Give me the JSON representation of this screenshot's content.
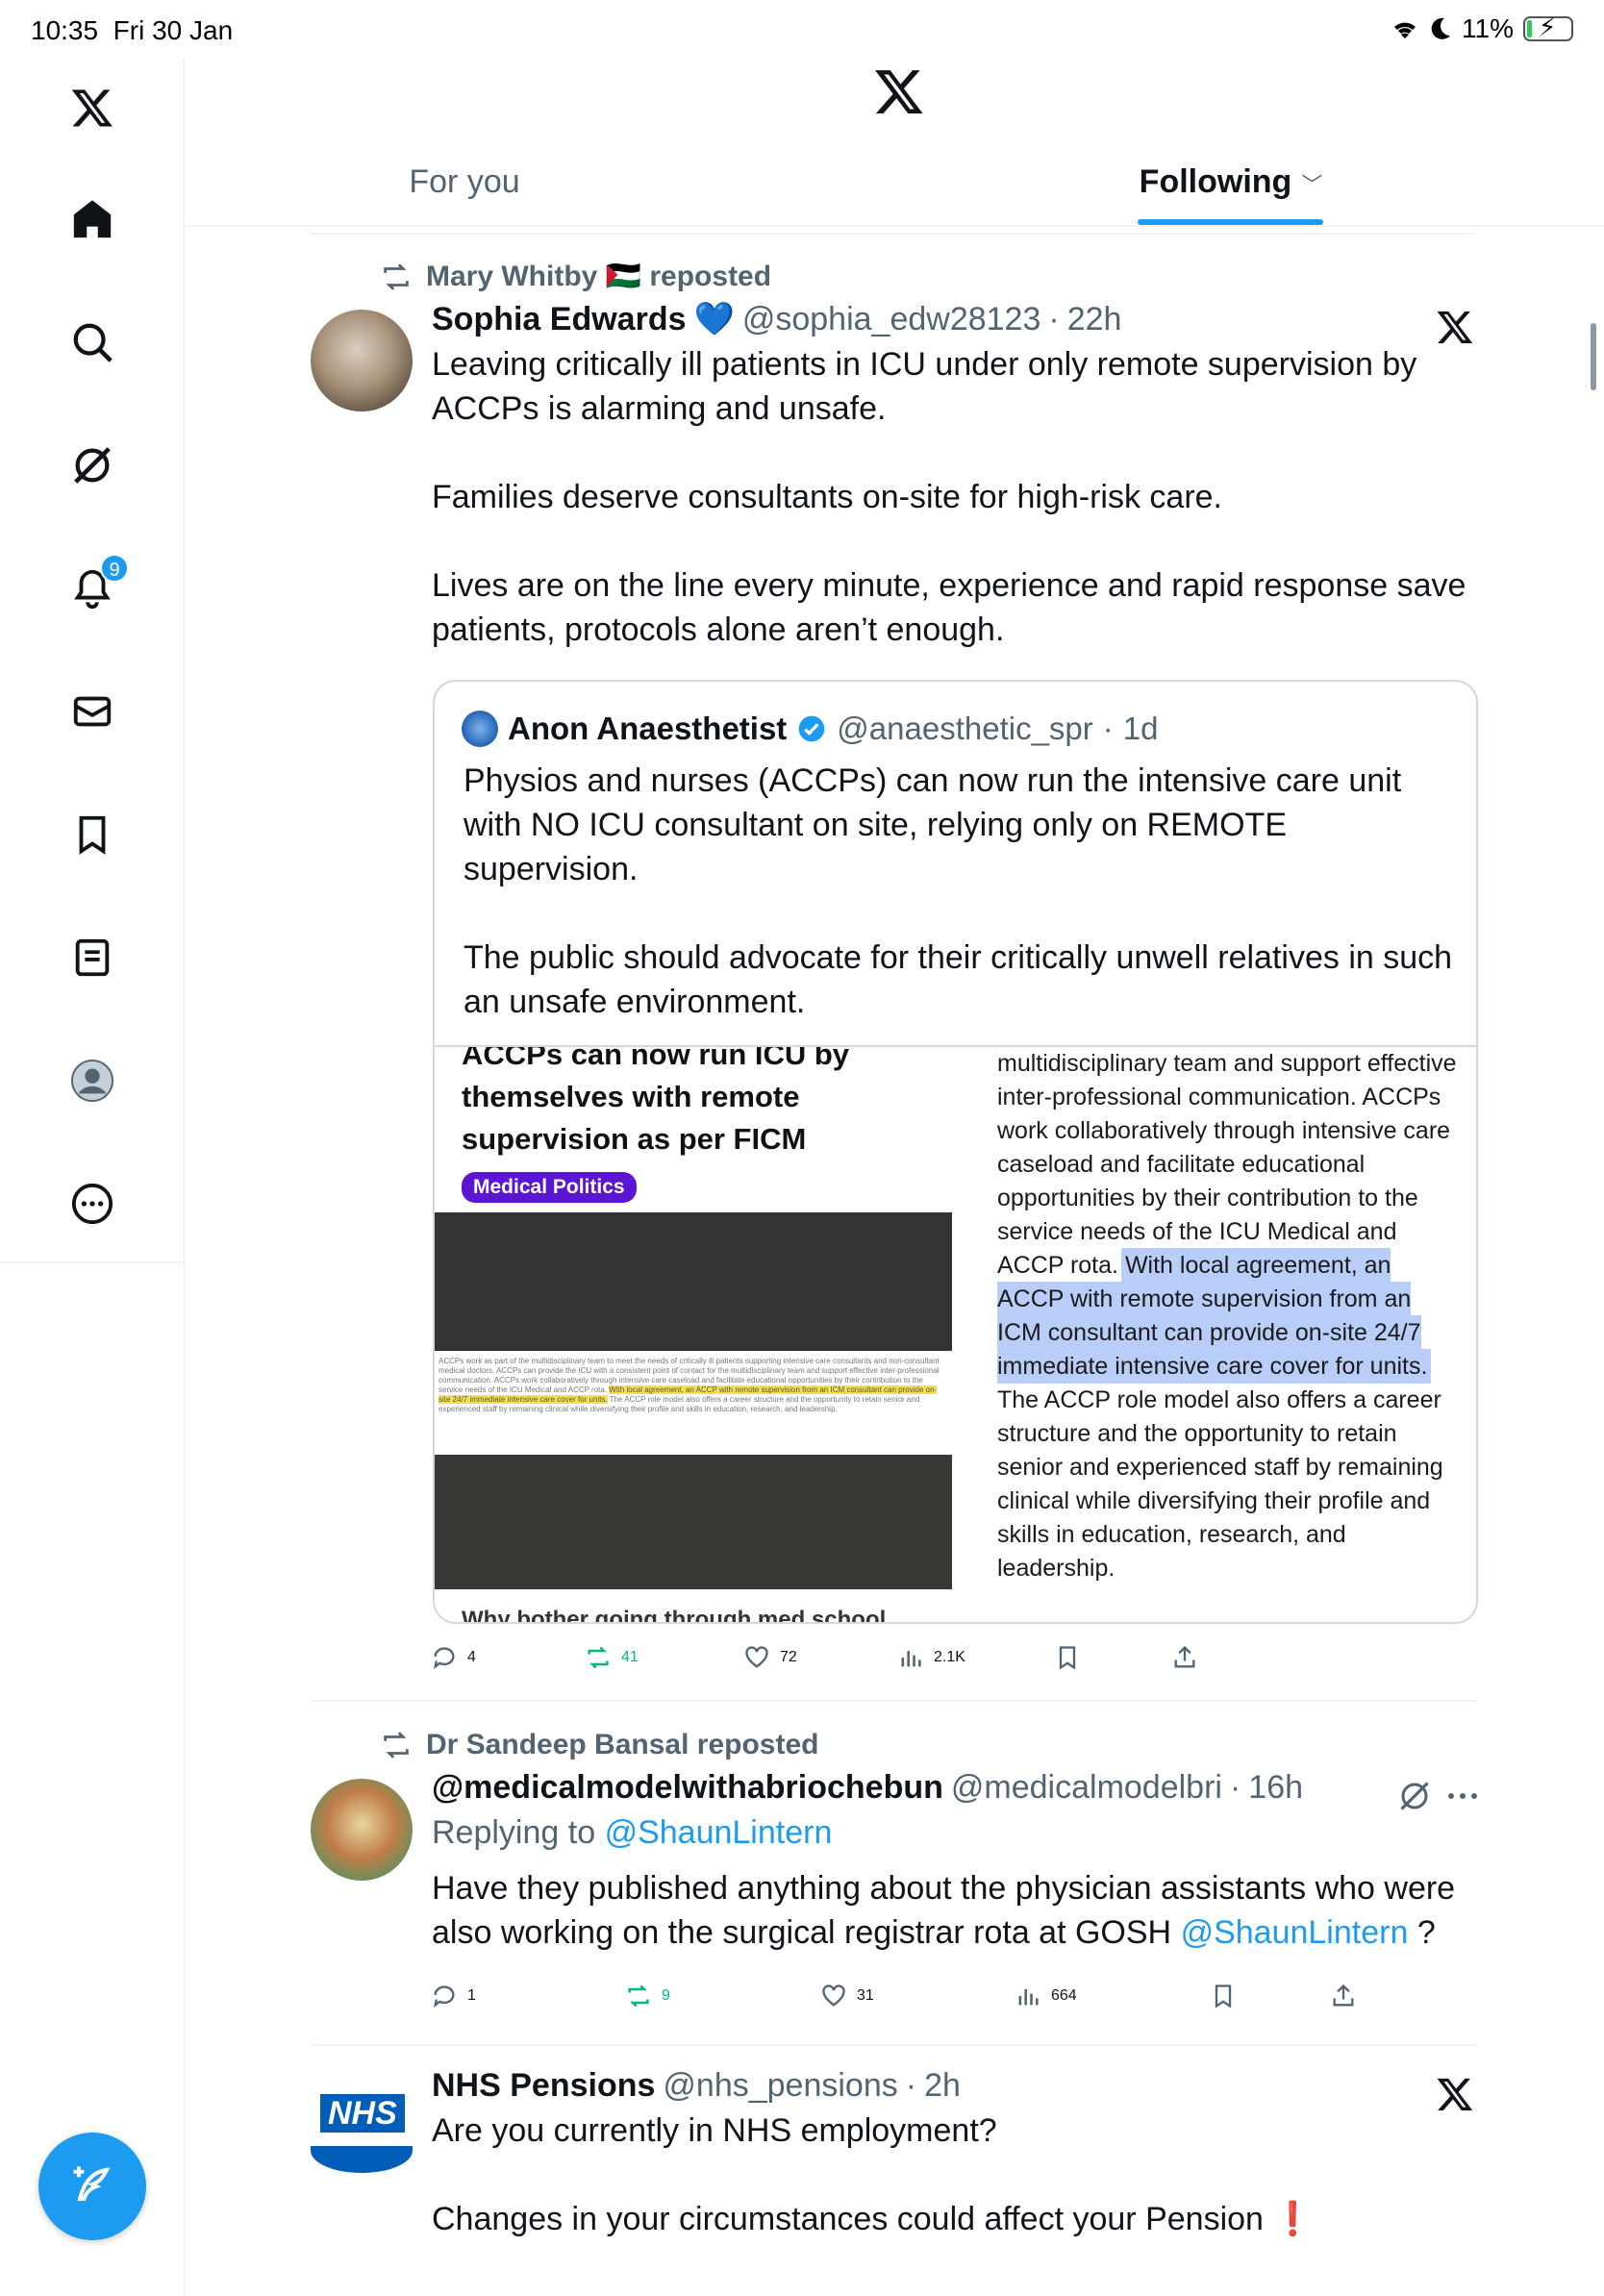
{
  "status_bar": {
    "time": "10:35",
    "date": "Fri 30 Jan",
    "battery": "11%",
    "battery_level": 0.11
  },
  "sidebar": {
    "items": [
      {
        "name": "home",
        "icon": "home-icon"
      },
      {
        "name": "explore",
        "icon": "search-icon"
      },
      {
        "name": "grok",
        "icon": "grok-icon"
      },
      {
        "name": "notifications",
        "icon": "bell-icon",
        "badge": "9"
      },
      {
        "name": "messages",
        "icon": "mail-icon"
      },
      {
        "name": "bookmarks",
        "icon": "bookmark-icon"
      },
      {
        "name": "lists",
        "icon": "list-icon"
      },
      {
        "name": "profile",
        "icon": "profile-icon"
      },
      {
        "name": "more",
        "icon": "more-icon"
      }
    ],
    "compose_icon": "compose-icon"
  },
  "header": {
    "tabs": [
      {
        "label": "For you",
        "active": false
      },
      {
        "label": "Following",
        "active": true
      }
    ]
  },
  "posts": [
    {
      "social_context": "Mary Whitby 🇵🇸 reposted",
      "name": "Sophia Edwards",
      "name_emoji": "💙",
      "handle": "@sophia_edw28123",
      "time": "22h",
      "paragraphs": [
        "Leaving critically ill patients in ICU under only remote supervision by ACCPs is alarming and unsafe.",
        "Families deserve consultants on-site for high-risk care.",
        "Lives are on the line every minute, experience and rapid response save patients, protocols alone aren’t enough."
      ],
      "quote": {
        "name": "Anon Anaesthetist",
        "handle": "@anaesthetic_spr",
        "time": "1d",
        "paragraphs": [
          "Physios and nurses (ACCPs) can now run the intensive care unit with NO ICU consultant on site, relying only on REMOTE supervision.",
          "The public should advocate for their critically unwell relatives in such an unsafe environment."
        ],
        "media": {
          "title": "ACCPs can now run ICU by themselves with remote supervision as per FICM",
          "pill": "Medical Politics",
          "small_text": "ACCPs work as part of the multidisciplinary team to meet the needs of critically ill patients supporting intensive care consultants and non-consultant medical doctors. ACCPs can provide the ICU with a consistent point of contact for the multidisciplinary team and support effective inter-professional communication. ACCPs work collaboratively through intensive care caseload and facilitate educational opportunities by their contribution to the service needs of the ICU Medical and ACCP rota.",
          "small_highlight": "With local agreement, an ACCP with remote supervision from an ICM consultant can provide on-site 24/7 immediate intensive care cover for units.",
          "small_tail": "The ACCP role model also offers a career structure and the opportunity to retain senior and experienced staff by remaining clinical while diversifying their profile and skills in education, research, and leadership.",
          "cut_text": "Why bother going through med school",
          "right_pre": "multidisciplinary team and support effective inter-professional communication. ACCPs work collaboratively through intensive care caseload and facilitate educational opportunities by their contribution to the service needs of the ICU Medical and ACCP rota.",
          "right_highlight": "With local agreement, an ACCP with remote supervision from an ICM consultant can provide on-site 24/7 immediate intensive care cover for units.",
          "right_post": "The ACCP role model also offers a career structure and the opportunity to retain senior and experienced staff by remaining clinical while diversifying their profile and skills in education, research, and leadership."
        }
      },
      "stats": {
        "replies": "4",
        "reposts": "41",
        "likes": "72",
        "views": "2.1K"
      }
    },
    {
      "social_context": "Dr Sandeep Bansal reposted",
      "name": "@medicalmodelwithabriochebun",
      "handle": "@medicalmodelbri",
      "time": "16h",
      "replying_prefix": "Replying to",
      "replying_to": "@ShaunLintern",
      "text_pre": "Have they published anything about the physician assistants who were also working on the surgical registrar rota at GOSH",
      "text_mention": "@ShaunLintern",
      "text_post": "?",
      "stats": {
        "replies": "1",
        "reposts": "9",
        "likes": "31",
        "views": "664"
      }
    },
    {
      "name": "NHS Pensions",
      "handle": "@nhs_pensions",
      "time": "2h",
      "avatar_text": "NHS",
      "paragraphs": [
        "Are you currently in NHS employment?",
        "Changes in your circumstances could affect your Pension ❗"
      ]
    }
  ],
  "colors": {
    "accent": "#1d9bf0",
    "repost_green": "#00ba7c",
    "secondary_text": "#536471",
    "pill": "#5b16d4"
  }
}
